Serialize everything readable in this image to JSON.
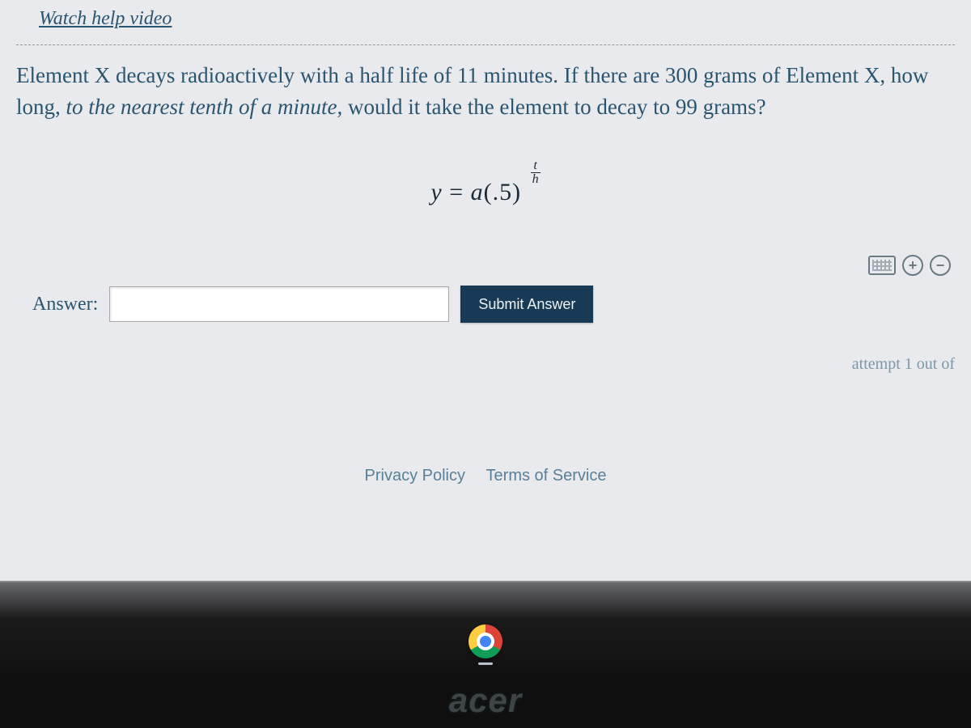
{
  "help_link_label": "Watch help video",
  "problem": {
    "prefix": "Element X decays radioactively with a half life of 11 minutes. If there are 300 grams of Element X, how long, ",
    "italic_part": "to the nearest tenth of a minute,",
    "suffix": " would it take the element to decay to 99 grams?"
  },
  "formula": {
    "lhs": "y",
    "eq": " = ",
    "coef": "a",
    "lparen": "(",
    "base_val": ".5",
    "rparen": ")",
    "exp_num": "t",
    "exp_den": "h"
  },
  "toolbar": {
    "keyboard_title": "Keyboard",
    "plus_label": "+",
    "minus_label": "−"
  },
  "answer": {
    "label": "Answer:",
    "value": "",
    "submit_label": "Submit Answer"
  },
  "attempt_text": "attempt 1 out of",
  "footer": {
    "privacy": "Privacy Policy",
    "terms": "Terms of Service"
  },
  "brand": "acer"
}
